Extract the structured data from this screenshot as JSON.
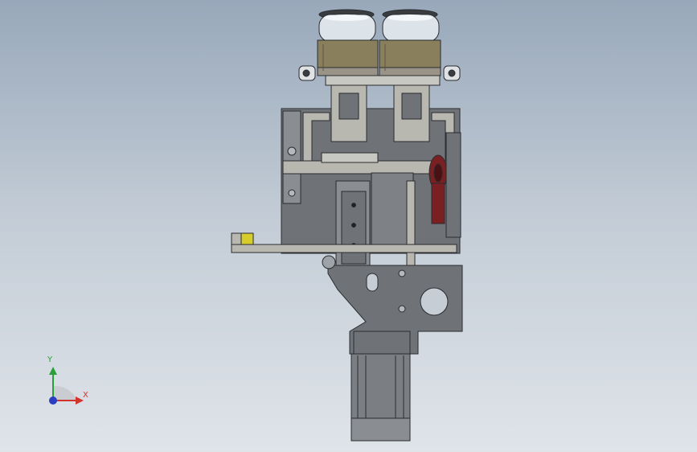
{
  "viewport": {
    "background_top": "#98a8ba",
    "background_bottom": "#dfe4e9"
  },
  "model": {
    "steel_color": "#6f7378",
    "edge_color": "#2a2c2f",
    "light_part_color": "#b8b8b0",
    "brass_color": "#8a7f5c",
    "glass_color": "#dce4ea",
    "wheel_color": "#7a1f22",
    "yellow_marker_color": "#d6cc2c"
  },
  "triad": {
    "x_label": "X",
    "y_label": "Y",
    "x_color": "#d0342c",
    "y_color": "#2b9e3c",
    "z_color": "#2a3fc0"
  }
}
